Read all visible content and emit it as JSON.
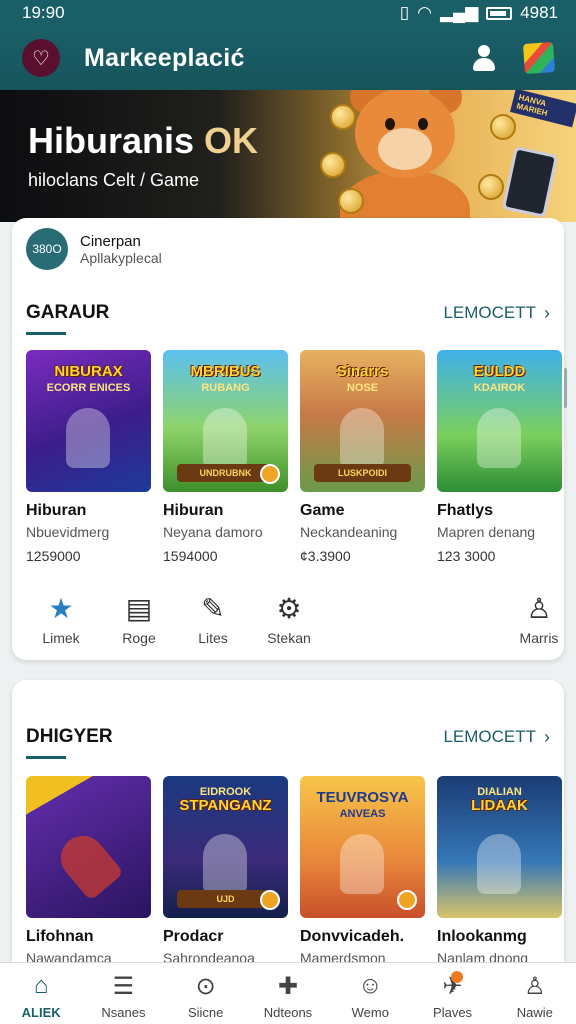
{
  "status": {
    "time": "19:90",
    "battery": "4981"
  },
  "app": {
    "title": "Markeeplacić"
  },
  "banner": {
    "title_white": "Hiburanis ",
    "title_accent": "OK",
    "subtitle": "hiloclans Celt / Game",
    "tag": "HANVA MARIEH"
  },
  "publisher": {
    "avatar": "380O",
    "name": "Cinerpan",
    "subtitle": "Apllakyplecal"
  },
  "section1": {
    "title": "GARAUR",
    "link": "LEMOCETT",
    "items": [
      {
        "thumb_title": "NIBURAX",
        "thumb_sub": "ECORR ENICES",
        "name": "Hiburan",
        "desc": "Nbuevidmerg",
        "price": "1259000",
        "color_class": "t1"
      },
      {
        "thumb_title": "MBRIBUS",
        "thumb_sub": "RUBANG",
        "name": "Hiburan",
        "desc": "Neyana damoro",
        "price": "1594000",
        "color_class": "t2",
        "plate": "UNDRUBNK"
      },
      {
        "thumb_title": "Sinarrs",
        "thumb_sub": "NOSE",
        "name": "Game",
        "desc": "Neckandeaning",
        "price": "¢3.3900",
        "color_class": "t3",
        "plate": "LUSKPOIDI"
      },
      {
        "thumb_title": "EULDD",
        "thumb_sub": "KDAIROK",
        "name": "Fhatlys",
        "desc": "Mapren denang",
        "price": "123 3000",
        "color_class": "t4"
      }
    ]
  },
  "actions": [
    {
      "label": "Limek",
      "icon": "star-icon",
      "glyph": "★"
    },
    {
      "label": "Roge",
      "icon": "document-icon",
      "glyph": "▤"
    },
    {
      "label": "Lites",
      "icon": "pen-icon",
      "glyph": "✎"
    },
    {
      "label": "Stekan",
      "icon": "settings-icon",
      "glyph": "⚙"
    },
    {
      "label": "Marris",
      "icon": "person-icon",
      "glyph": "♙"
    }
  ],
  "section2": {
    "title": "DHIGYER",
    "link": "LEMOCETT",
    "items": [
      {
        "thumb_title": "",
        "thumb_sub": "",
        "name": "Lifohnan",
        "desc": "Nawandamca",
        "color_class": "t5"
      },
      {
        "thumb_title": "STPANGANZ",
        "thumb_sub": "EIDROOK",
        "name": "Prodacr",
        "desc": "Sahrondeanoa",
        "color_class": "t6",
        "plate": "UJD"
      },
      {
        "thumb_title": "TEUVROSYA",
        "thumb_sub": "ANVEAS",
        "name": "Donvvicadeh.",
        "desc": "Mamerdsmon",
        "color_class": "t7"
      },
      {
        "thumb_title": "LIDAAK",
        "thumb_sub": "DIALIAN",
        "name": "Inlookanmg",
        "desc": "Nanlam dnong",
        "color_class": "t8"
      }
    ]
  },
  "bottom_nav": [
    {
      "label": "ALIEK",
      "icon": "home-icon",
      "glyph": "⌂",
      "active": true
    },
    {
      "label": "Nsanes",
      "icon": "list-icon",
      "glyph": "☰"
    },
    {
      "label": "Siicne",
      "icon": "search-icon",
      "glyph": "⊙"
    },
    {
      "label": "Ndteons",
      "icon": "book-icon",
      "glyph": "✚"
    },
    {
      "label": "Wemo",
      "icon": "profile-icon",
      "glyph": "☺"
    },
    {
      "label": "Plaves",
      "icon": "plane-icon",
      "glyph": "✈",
      "dot": true
    },
    {
      "label": "Nawie",
      "icon": "user-icon",
      "glyph": "♙"
    }
  ],
  "colors": {
    "primary": "#1a5f68",
    "background": "#eef1f2",
    "accent": "#f07a20"
  }
}
